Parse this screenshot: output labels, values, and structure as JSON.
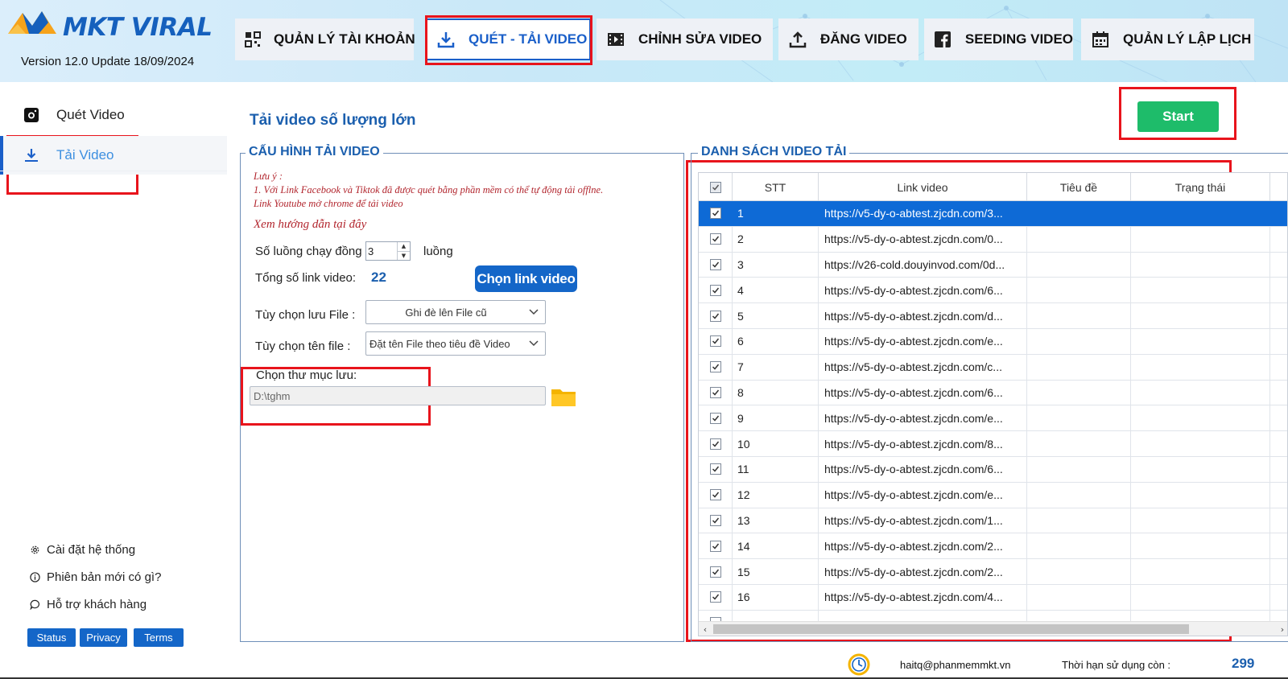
{
  "app": {
    "logo_text": "MKT VIRAL",
    "version": "Version  12.0 Update 18/09/2024"
  },
  "tabs": [
    {
      "label": "QUẢN LÝ TÀI KHOẢN",
      "icon": "grid-icon",
      "active": false
    },
    {
      "label": "QUÉT - TẢI VIDEO",
      "icon": "download-icon",
      "active": true
    },
    {
      "label": "CHỈNH SỬA VIDEO",
      "icon": "film-icon",
      "active": false
    },
    {
      "label": "ĐĂNG VIDEO",
      "icon": "upload-icon",
      "active": false
    },
    {
      "label": "SEEDING VIDEO",
      "icon": "facebook-icon",
      "active": false
    },
    {
      "label": "QUẢN LÝ LẬP LỊCH",
      "icon": "calendar-icon",
      "active": false
    }
  ],
  "sidebar": {
    "items": [
      {
        "label": "Quét Video",
        "icon": "camera-icon",
        "active": false
      },
      {
        "label": "Tải Video",
        "icon": "download-icon",
        "active": true
      }
    ],
    "links": [
      {
        "label": "Cài đặt hệ thống",
        "icon": "gear-icon"
      },
      {
        "label": "Phiên bản mới có gì?",
        "icon": "info-icon"
      },
      {
        "label": "Hỗ trợ khách hàng",
        "icon": "chat-icon"
      }
    ],
    "pills": [
      "Status",
      "Privacy",
      "Terms"
    ]
  },
  "main": {
    "title": "Tải video số lượng lớn",
    "start_label": "Start"
  },
  "config": {
    "group_title": "CẤU HÌNH TẢI VIDEO",
    "note_title": "Lưu ý :",
    "note_line1": "1. Với Link Facebook và Tiktok đã được quét bằng phần mềm có thể tự động tải offlne.",
    "note_line2": "Link Youtube mở chrome để tải video",
    "guide_link": "Xem hướng dẫn tại đây",
    "threads_label": "Số luồng chạy đồng",
    "threads_value": "3",
    "threads_unit": "luồng",
    "total_label": "Tổng số link video:",
    "total_value": "22",
    "choose_button": "Chọn link video",
    "save_option_label": "Tùy chọn lưu File :",
    "save_option_value": "Ghi đè lên File cũ",
    "name_option_label": "Tùy chọn tên file :",
    "name_option_value": "Đặt tên File theo tiêu đề Video",
    "folder_label": "Chọn thư mục lưu:",
    "folder_value": "D:\\tghm"
  },
  "video_list": {
    "group_title": "DANH SÁCH VIDEO TẢI",
    "columns": [
      "STT",
      "Link video",
      "Tiêu đề",
      "Trạng thái"
    ],
    "rows": [
      {
        "stt": "1",
        "link": "https://v5-dy-o-abtest.zjcdn.com/3...",
        "selected": true
      },
      {
        "stt": "2",
        "link": "https://v5-dy-o-abtest.zjcdn.com/0...",
        "selected": false
      },
      {
        "stt": "3",
        "link": "https://v26-cold.douyinvod.com/0d...",
        "selected": false
      },
      {
        "stt": "4",
        "link": "https://v5-dy-o-abtest.zjcdn.com/6...",
        "selected": false
      },
      {
        "stt": "5",
        "link": "https://v5-dy-o-abtest.zjcdn.com/d...",
        "selected": false
      },
      {
        "stt": "6",
        "link": "https://v5-dy-o-abtest.zjcdn.com/e...",
        "selected": false
      },
      {
        "stt": "7",
        "link": "https://v5-dy-o-abtest.zjcdn.com/c...",
        "selected": false
      },
      {
        "stt": "8",
        "link": "https://v5-dy-o-abtest.zjcdn.com/6...",
        "selected": false
      },
      {
        "stt": "9",
        "link": "https://v5-dy-o-abtest.zjcdn.com/e...",
        "selected": false
      },
      {
        "stt": "10",
        "link": "https://v5-dy-o-abtest.zjcdn.com/8...",
        "selected": false
      },
      {
        "stt": "11",
        "link": "https://v5-dy-o-abtest.zjcdn.com/6...",
        "selected": false
      },
      {
        "stt": "12",
        "link": "https://v5-dy-o-abtest.zjcdn.com/e...",
        "selected": false
      },
      {
        "stt": "13",
        "link": "https://v5-dy-o-abtest.zjcdn.com/1...",
        "selected": false
      },
      {
        "stt": "14",
        "link": "https://v5-dy-o-abtest.zjcdn.com/2...",
        "selected": false
      },
      {
        "stt": "15",
        "link": "https://v5-dy-o-abtest.zjcdn.com/2...",
        "selected": false
      },
      {
        "stt": "16",
        "link": "https://v5-dy-o-abtest.zjcdn.com/4...",
        "selected": false
      }
    ]
  },
  "footer": {
    "email": "haitq@phanmemmkt.vn",
    "expiry_label": "Thời hạn sử dụng còn :",
    "expiry_days": "299"
  },
  "colors": {
    "brand_blue": "#1466c8",
    "start_green": "#1ebc6a",
    "highlight_red": "#e8141c",
    "selected_row": "#0e6ad6",
    "note_red": "#b2262e"
  }
}
